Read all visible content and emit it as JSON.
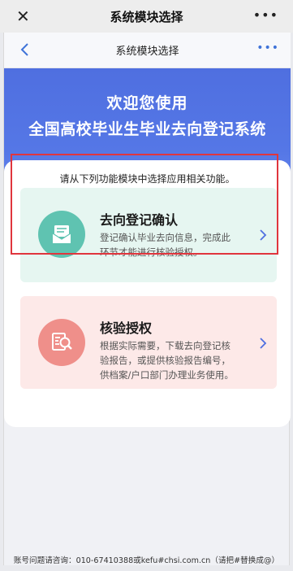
{
  "outer_bar": {
    "close_glyph": "✕",
    "title": "系统模块选择",
    "more_glyph": "•••"
  },
  "inner_bar": {
    "title": "系统模块选择",
    "more_glyph": "•••"
  },
  "banner": {
    "line1": "欢迎您使用",
    "line2": "全国高校毕业生毕业去向登记系统"
  },
  "intro": "请从下列功能模块中选择应用相关功能。",
  "modules": [
    {
      "title": "去向登记确认",
      "desc_lines": [
        "登记确认毕业去向信息，完成此",
        "环节才能进行核验授权。"
      ],
      "color": "#5fc3b1",
      "icon": "document-envelope-icon"
    },
    {
      "title": "核验授权",
      "desc_lines": [
        "根据实际需要，下载去向登记核",
        "验报告，或提供核验报告编号，",
        "供档案/户口部门办理业务使用。"
      ],
      "color": "#ef8f8a",
      "icon": "verify-search-icon"
    }
  ],
  "footer": "账号问题请咨询：010-67410388或kefu#chsi.com.cn（请把#替换成@）",
  "colors": {
    "accent": "#4f6fe0",
    "highlight_border": "#e0353d"
  }
}
